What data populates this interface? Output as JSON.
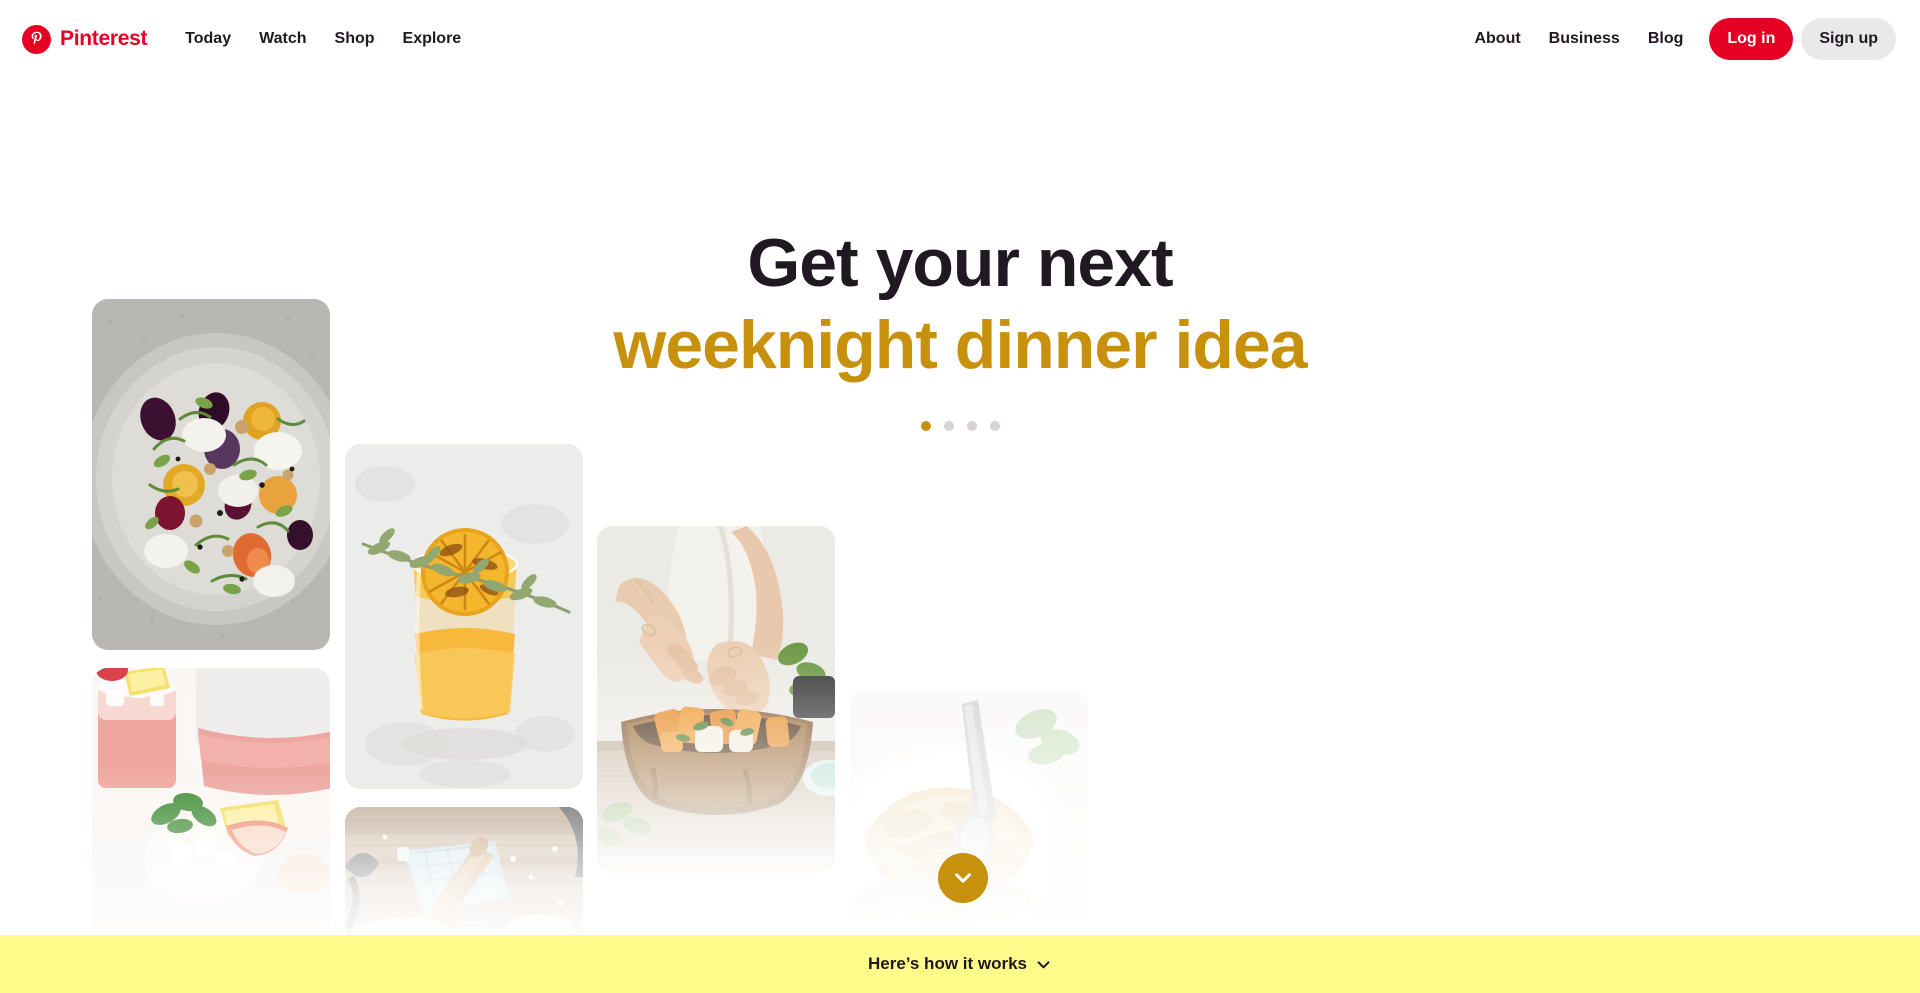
{
  "header": {
    "brand": "Pinterest",
    "brand_icon": "pinterest-logo-icon",
    "nav_left": [
      {
        "label": "Today"
      },
      {
        "label": "Watch"
      },
      {
        "label": "Shop"
      },
      {
        "label": "Explore"
      }
    ],
    "nav_right": [
      {
        "label": "About"
      },
      {
        "label": "Business"
      },
      {
        "label": "Blog"
      }
    ],
    "login_label": "Log in",
    "signup_label": "Sign up"
  },
  "hero": {
    "line1": "Get your next",
    "line2": "weeknight dinner idea",
    "carousel": {
      "count": 4,
      "active_index": 0
    }
  },
  "scroll_button": {
    "icon": "chevron-down-icon"
  },
  "bottom_bar": {
    "label": "Here’s how it works",
    "icon": "chevron-down-icon"
  },
  "gallery": {
    "tiles": [
      {
        "id": "salad",
        "alt": "Beet and goat cheese salad on a gray ceramic plate"
      },
      {
        "id": "drinks",
        "alt": "Pink lemonade with mint, lemon and peach slices"
      },
      {
        "id": "cocktail",
        "alt": "Orange cocktail with grilled citrus wheel and thyme"
      },
      {
        "id": "baking",
        "alt": "Rolling pin and blue oven mitt on floured wooden board"
      },
      {
        "id": "bowl",
        "alt": "Hands garnishing a wooden bowl of roasted vegetables"
      },
      {
        "id": "dip",
        "alt": "Creamy hummus dip in a white bowl with a spoon"
      }
    ]
  },
  "colors": {
    "brand_red": "#E60023",
    "accent_gold": "#C8910D",
    "bottom_bar_yellow": "#FDFB89",
    "text_dark": "#211922",
    "dot_inactive": "#D6D3D1",
    "signup_grey": "#E9E9E9"
  }
}
